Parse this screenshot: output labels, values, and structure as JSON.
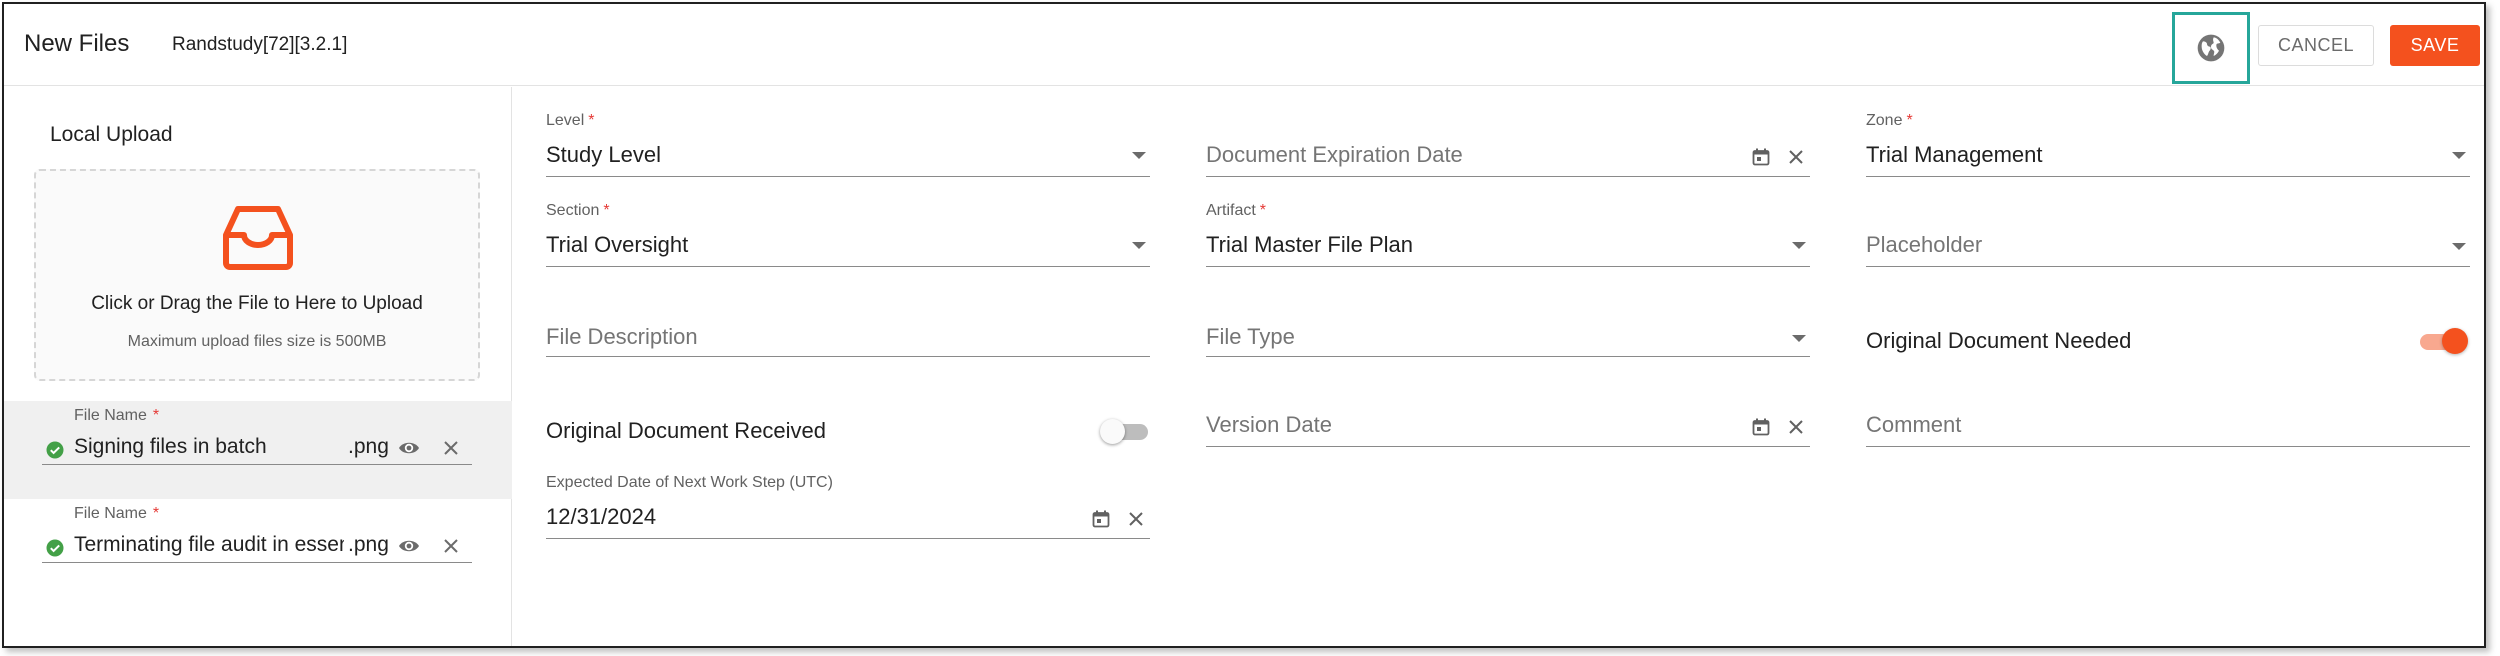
{
  "header": {
    "title": "New Files",
    "study": "Randstudy[72][3.2.1]",
    "language_icon": "globe-icon",
    "cancel_label": "CANCEL",
    "save_label": "SAVE"
  },
  "colors": {
    "accent": "#f4511e",
    "highlight_box": "#26a69a",
    "required": "#e53935",
    "success": "#43a047"
  },
  "upload": {
    "heading": "Local Upload",
    "icon": "inbox-tray-icon",
    "instruction": "Click or Drag the File to Here to Upload",
    "limit": "Maximum upload files size is 500MB"
  },
  "files": [
    {
      "label": "File Name",
      "required": "*",
      "name": "Signing files in batch",
      "ext": ".png",
      "status_icon": "check-circle-icon"
    },
    {
      "label": "File Name",
      "required": "*",
      "name": "Terminating file audit in essential",
      "ext": ".png",
      "status_icon": "check-circle-icon"
    }
  ],
  "form": {
    "level": {
      "label": "Level",
      "required": "*",
      "value": "Study Level"
    },
    "doc_expiration": {
      "placeholder": "Document Expiration Date"
    },
    "zone": {
      "label": "Zone",
      "required": "*",
      "value": "Trial Management"
    },
    "section": {
      "label": "Section",
      "required": "*",
      "value": "Trial Oversight"
    },
    "artifact": {
      "label": "Artifact",
      "required": "*",
      "value": "Trial Master File Plan"
    },
    "placeholder_field": {
      "placeholder": "Placeholder"
    },
    "file_description": {
      "placeholder": "File Description"
    },
    "file_type": {
      "placeholder": "File Type"
    },
    "original_needed": {
      "label": "Original Document Needed",
      "on": true
    },
    "original_received": {
      "label": "Original Document Received",
      "on": false
    },
    "version_date": {
      "placeholder": "Version Date"
    },
    "comment": {
      "placeholder": "Comment"
    },
    "expected_date": {
      "label": "Expected Date of Next Work Step (UTC)",
      "value": "12/31/2024"
    }
  }
}
